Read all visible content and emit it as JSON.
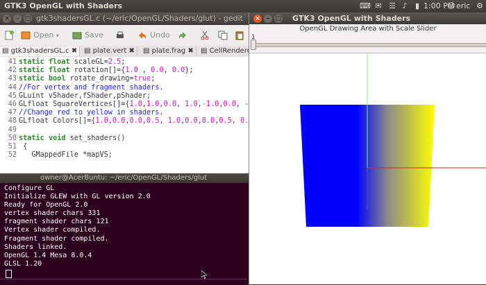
{
  "topbar": {
    "title": "GTK3 OpenGL with Shaders",
    "time": "1:00 PM",
    "user": "eric"
  },
  "gedit": {
    "title": "gtk3shadersGL.c (~/eric/OpenGL/Shaders/glut) - gedit",
    "toolbar": {
      "open": "Open",
      "save": "Save",
      "undo": "Undo"
    },
    "tabs": [
      "gtk3shadersGL.c",
      "plate.vert",
      "plate.frag",
      "CellRendere"
    ],
    "lines": [
      {
        "n": "41",
        "html": "<span class='kw'>static</span> <span class='ty'>float</span> scaleGL=<span class='num'>2.5</span>;"
      },
      {
        "n": "42",
        "html": "<span class='kw'>static</span> <span class='ty'>float</span> rotation[]={<span class='num'>1.0</span> , <span class='num'>0.0</span>, <span class='num'>0.0</span>};"
      },
      {
        "n": "43",
        "html": "<span class='kw'>static</span> <span class='ty'>bool</span> rotate_drawing=<span class='num'>true</span>;"
      },
      {
        "n": "44",
        "html": "<span class='cm'>//For vertex and fragment shaders.</span>"
      },
      {
        "n": "45",
        "html": "GLuint vShader,fShader,pShader;"
      },
      {
        "n": "46",
        "html": "GLfloat SquareVertices[]={<span class='num'>1.0</span>,<span class='num'>1.0</span>,<span class='num'>0.0</span>, <span class='num'>1.0</span>,<span class='num'>-1.0</span>,<span class='num'>0.0</span>, -"
      },
      {
        "n": "47",
        "html": "<span class='cm'>//Change red to yellow in shaders.</span>"
      },
      {
        "n": "48",
        "html": "GLfloat Colors[]={<span class='num'>1.0</span>,<span class='num'>0.0</span>,<span class='num'>0.0</span>,<span class='num'>0.5</span>, <span class='num'>1.0</span>,<span class='num'>0.0</span>,<span class='num'>0.0</span>,<span class='num'>0.5</span>, <span class='num'>0.</span>"
      },
      {
        "n": "49",
        "html": ""
      },
      {
        "n": "50",
        "html": "<span class='kw'>static</span> <span class='ty'>void</span> set_shaders()"
      },
      {
        "n": "51",
        "html": " {"
      },
      {
        "n": "52",
        "html": "   GMappedFile *mapVS;"
      }
    ]
  },
  "terminal": {
    "title": "owner@AcerBuntu: ~/eric/OpenGL/Shaders/glut",
    "lines": [
      "Configure GL",
      "Initialize GLEW with GL version 2.0",
      "Ready for OpenGL 2.0",
      "vertex shader chars 331",
      "fragment shader chars 121",
      "Vertex shader compiled.",
      "Fragment shader compiled.",
      "Shaders linked.",
      "OpenGL 1.4 Mesa 8.0.4",
      "GLSL 1.20"
    ]
  },
  "glwindow": {
    "title": "GTK3 OpenGL with Shaders",
    "subtitle": "OpenGL Drawing Area with Scale Slider",
    "slider_value": "1",
    "colors": {
      "left": "#0000ff",
      "right": "#ffff00",
      "axis_x": "#e02020",
      "axis_y": "#90e090",
      "axis_z": "#4060c0"
    }
  }
}
